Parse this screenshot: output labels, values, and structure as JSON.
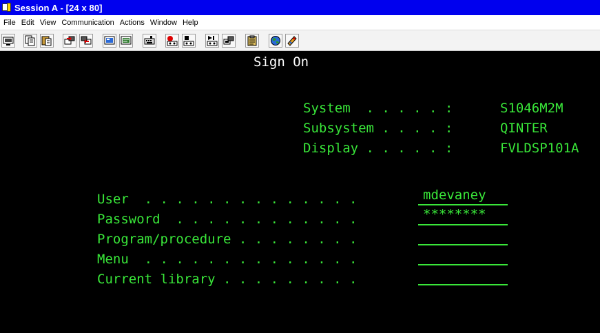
{
  "window": {
    "title": "Session A - [24 x 80]"
  },
  "menu": [
    "File",
    "Edit",
    "View",
    "Communication",
    "Actions",
    "Window",
    "Help"
  ],
  "toolbar": {
    "icons": [
      "display-icon",
      "copy-icon",
      "paste-icon",
      "send-icon",
      "receive-icon",
      "screen-icon",
      "screen-alt-icon",
      "keyboard-icon",
      "record-macro-icon",
      "stop-macro-icon",
      "play-macro-icon",
      "macro-icon",
      "clipboard-icon",
      "globe-icon",
      "help-icon"
    ]
  },
  "screen": {
    "heading": "Sign On",
    "system": {
      "label": "System  . . . . . :",
      "value": "S1046M2M"
    },
    "subsystem": {
      "label": "Subsystem . . . . :",
      "value": "QINTER"
    },
    "display": {
      "label": "Display . . . . . :",
      "value": "FVLDSP101A"
    },
    "fields": [
      {
        "label": "User  . . . . . . . . . . . . . .",
        "value": "mdevaney"
      },
      {
        "label": "Password  . . . . . . . . . . . .",
        "value": "********"
      },
      {
        "label": "Program/procedure . . . . . . . .",
        "value": ""
      },
      {
        "label": "Menu  . . . . . . . . . . . . . .",
        "value": ""
      },
      {
        "label": "Current library . . . . . . . . .",
        "value": ""
      }
    ]
  },
  "colors": {
    "title_bar": "#0000ee",
    "terminal_green": "#39e639",
    "terminal_bg": "#000000"
  }
}
